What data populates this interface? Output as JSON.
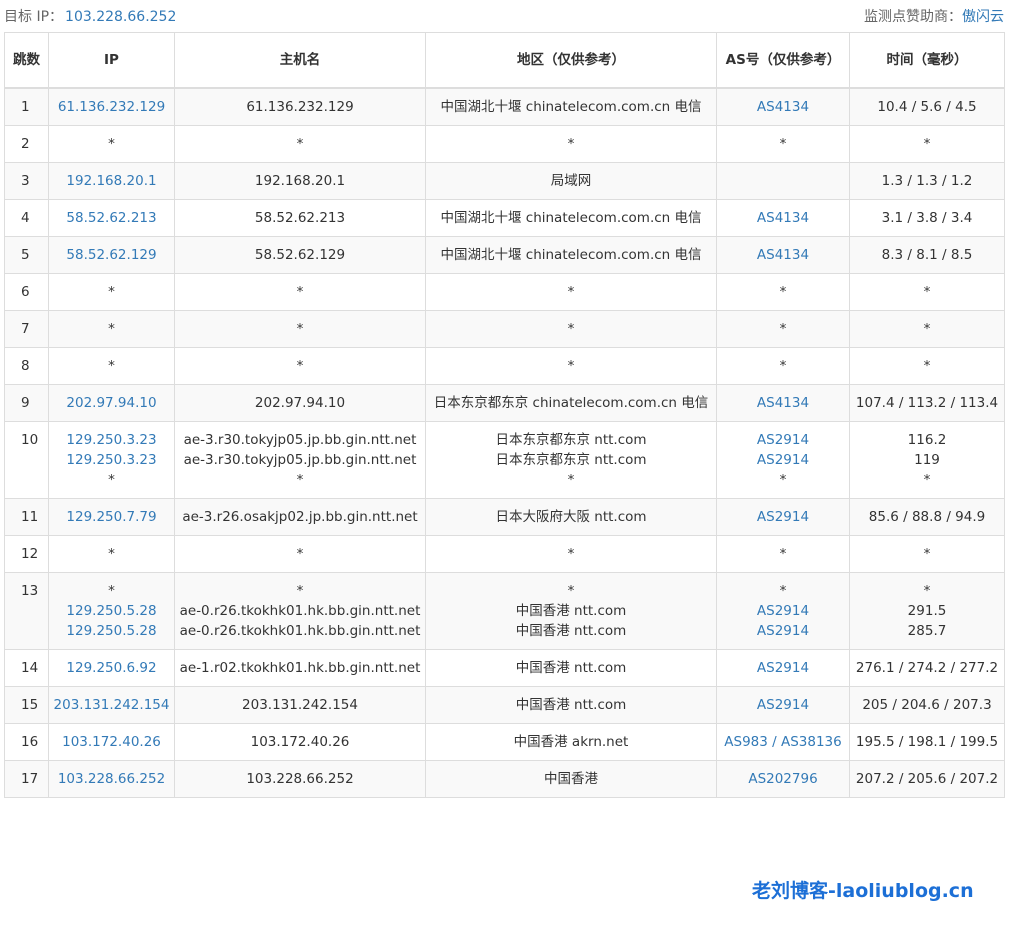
{
  "header": {
    "target_label": "目标 IP：",
    "target_ip": "103.228.66.252",
    "sponsor_label": "监测点赞助商：",
    "sponsor_name": "傲闪云"
  },
  "columns": [
    "跳数",
    "IP",
    "主机名",
    "地区（仅供参考）",
    "AS号（仅供参考）",
    "时间（毫秒）"
  ],
  "rows": [
    {
      "hop": "1",
      "ip": [
        "61.136.232.129"
      ],
      "host": [
        "61.136.232.129"
      ],
      "region": [
        "中国湖北十堰 chinatelecom.com.cn 电信"
      ],
      "as": [
        "AS4134"
      ],
      "time": [
        "10.4 / 5.6 / 4.5"
      ]
    },
    {
      "hop": "2",
      "ip": [
        "*"
      ],
      "host": [
        "*"
      ],
      "region": [
        "*"
      ],
      "as": [
        "*"
      ],
      "time": [
        "*"
      ]
    },
    {
      "hop": "3",
      "ip": [
        "192.168.20.1"
      ],
      "host": [
        "192.168.20.1"
      ],
      "region": [
        "局域网"
      ],
      "as": [
        ""
      ],
      "time": [
        "1.3 / 1.3 / 1.2"
      ]
    },
    {
      "hop": "4",
      "ip": [
        "58.52.62.213"
      ],
      "host": [
        "58.52.62.213"
      ],
      "region": [
        "中国湖北十堰 chinatelecom.com.cn 电信"
      ],
      "as": [
        "AS4134"
      ],
      "time": [
        "3.1 / 3.8 / 3.4"
      ]
    },
    {
      "hop": "5",
      "ip": [
        "58.52.62.129"
      ],
      "host": [
        "58.52.62.129"
      ],
      "region": [
        "中国湖北十堰 chinatelecom.com.cn 电信"
      ],
      "as": [
        "AS4134"
      ],
      "time": [
        "8.3 / 8.1 / 8.5"
      ]
    },
    {
      "hop": "6",
      "ip": [
        "*"
      ],
      "host": [
        "*"
      ],
      "region": [
        "*"
      ],
      "as": [
        "*"
      ],
      "time": [
        "*"
      ]
    },
    {
      "hop": "7",
      "ip": [
        "*"
      ],
      "host": [
        "*"
      ],
      "region": [
        "*"
      ],
      "as": [
        "*"
      ],
      "time": [
        "*"
      ]
    },
    {
      "hop": "8",
      "ip": [
        "*"
      ],
      "host": [
        "*"
      ],
      "region": [
        "*"
      ],
      "as": [
        "*"
      ],
      "time": [
        "*"
      ]
    },
    {
      "hop": "9",
      "ip": [
        "202.97.94.10"
      ],
      "host": [
        "202.97.94.10"
      ],
      "region": [
        "日本东京都东京 chinatelecom.com.cn 电信"
      ],
      "as": [
        "AS4134"
      ],
      "time": [
        "107.4 / 113.2 / 113.4"
      ]
    },
    {
      "hop": "10",
      "ip": [
        "129.250.3.23",
        "129.250.3.23",
        "*"
      ],
      "host": [
        "ae-3.r30.tokyjp05.jp.bb.gin.ntt.net",
        "ae-3.r30.tokyjp05.jp.bb.gin.ntt.net",
        "*"
      ],
      "region": [
        "日本东京都东京 ntt.com",
        "日本东京都东京 ntt.com",
        "*"
      ],
      "as": [
        "AS2914",
        "AS2914",
        "*"
      ],
      "time": [
        "116.2",
        "119",
        "*"
      ]
    },
    {
      "hop": "11",
      "ip": [
        "129.250.7.79"
      ],
      "host": [
        "ae-3.r26.osakjp02.jp.bb.gin.ntt.net"
      ],
      "region": [
        "日本大阪府大阪 ntt.com"
      ],
      "as": [
        "AS2914"
      ],
      "time": [
        "85.6 / 88.8 / 94.9"
      ]
    },
    {
      "hop": "12",
      "ip": [
        "*"
      ],
      "host": [
        "*"
      ],
      "region": [
        "*"
      ],
      "as": [
        "*"
      ],
      "time": [
        "*"
      ]
    },
    {
      "hop": "13",
      "ip": [
        "*",
        "129.250.5.28",
        "129.250.5.28"
      ],
      "host": [
        "*",
        "ae-0.r26.tkokhk01.hk.bb.gin.ntt.net",
        "ae-0.r26.tkokhk01.hk.bb.gin.ntt.net"
      ],
      "region": [
        "*",
        "中国香港 ntt.com",
        "中国香港 ntt.com"
      ],
      "as": [
        "*",
        "AS2914",
        "AS2914"
      ],
      "time": [
        "*",
        "291.5",
        "285.7"
      ]
    },
    {
      "hop": "14",
      "ip": [
        "129.250.6.92"
      ],
      "host": [
        "ae-1.r02.tkokhk01.hk.bb.gin.ntt.net"
      ],
      "region": [
        "中国香港 ntt.com"
      ],
      "as": [
        "AS2914"
      ],
      "time": [
        "276.1 / 274.2 / 277.2"
      ]
    },
    {
      "hop": "15",
      "ip": [
        "203.131.242.154"
      ],
      "host": [
        "203.131.242.154"
      ],
      "region": [
        "中国香港 ntt.com"
      ],
      "as": [
        "AS2914"
      ],
      "time": [
        "205 / 204.6 / 207.3"
      ]
    },
    {
      "hop": "16",
      "ip": [
        "103.172.40.26"
      ],
      "host": [
        "103.172.40.26"
      ],
      "region": [
        "中国香港 akrn.net"
      ],
      "as": [
        "AS983 / AS38136"
      ],
      "time": [
        "195.5 / 198.1 / 199.5"
      ]
    },
    {
      "hop": "17",
      "ip": [
        "103.228.66.252"
      ],
      "host": [
        "103.228.66.252"
      ],
      "region": [
        "中国香港"
      ],
      "as": [
        "AS202796"
      ],
      "time": [
        "207.2 / 205.6 / 207.2"
      ]
    }
  ],
  "watermark": "老刘博客-laoliublog.cn",
  "colors": {
    "link": "#337ab7",
    "watermark": "#1c6fd6",
    "border": "#dddddd",
    "stripe": "#f9f9f9"
  }
}
